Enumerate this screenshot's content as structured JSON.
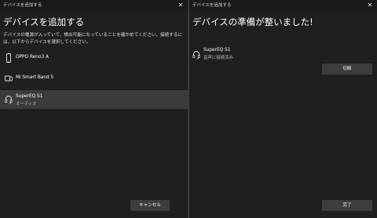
{
  "left_window": {
    "title": "デバイスを追加する",
    "heading": "デバイスを追加する",
    "description": "デバイスの電源が入っていて、検出可能になっていることを確かめてください。接続するには、以下からデバイスを選択してください。",
    "devices": [
      {
        "name": "OPPO Reno3 A",
        "subtitle": "",
        "icon": "phone-icon",
        "selected": false
      },
      {
        "name": "Mi Smart Band 5",
        "subtitle": "",
        "icon": "device-icon",
        "selected": false
      },
      {
        "name": "SuperEQ S1",
        "subtitle": "オーディオ",
        "icon": "headset-icon",
        "selected": true
      }
    ],
    "cancel_label": "キャンセル"
  },
  "right_window": {
    "title": "デバイスを追加する",
    "heading": "デバイスの準備が整いました!",
    "device": {
      "name": "SuperEQ S1",
      "status": "音声に接続済み",
      "icon": "headset-icon"
    },
    "disconnect_label": "切断",
    "done_label": "完了"
  }
}
